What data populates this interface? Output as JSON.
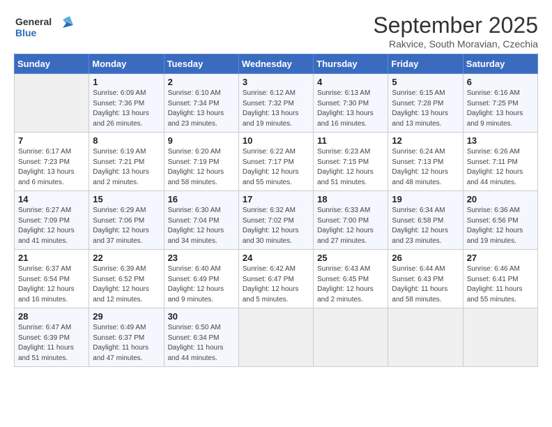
{
  "header": {
    "logo_line1": "General",
    "logo_line2": "Blue",
    "month": "September 2025",
    "location": "Rakvice, South Moravian, Czechia"
  },
  "days_of_week": [
    "Sunday",
    "Monday",
    "Tuesday",
    "Wednesday",
    "Thursday",
    "Friday",
    "Saturday"
  ],
  "weeks": [
    [
      {
        "num": "",
        "info": ""
      },
      {
        "num": "1",
        "info": "Sunrise: 6:09 AM\nSunset: 7:36 PM\nDaylight: 13 hours\nand 26 minutes."
      },
      {
        "num": "2",
        "info": "Sunrise: 6:10 AM\nSunset: 7:34 PM\nDaylight: 13 hours\nand 23 minutes."
      },
      {
        "num": "3",
        "info": "Sunrise: 6:12 AM\nSunset: 7:32 PM\nDaylight: 13 hours\nand 19 minutes."
      },
      {
        "num": "4",
        "info": "Sunrise: 6:13 AM\nSunset: 7:30 PM\nDaylight: 13 hours\nand 16 minutes."
      },
      {
        "num": "5",
        "info": "Sunrise: 6:15 AM\nSunset: 7:28 PM\nDaylight: 13 hours\nand 13 minutes."
      },
      {
        "num": "6",
        "info": "Sunrise: 6:16 AM\nSunset: 7:25 PM\nDaylight: 13 hours\nand 9 minutes."
      }
    ],
    [
      {
        "num": "7",
        "info": "Sunrise: 6:17 AM\nSunset: 7:23 PM\nDaylight: 13 hours\nand 6 minutes."
      },
      {
        "num": "8",
        "info": "Sunrise: 6:19 AM\nSunset: 7:21 PM\nDaylight: 13 hours\nand 2 minutes."
      },
      {
        "num": "9",
        "info": "Sunrise: 6:20 AM\nSunset: 7:19 PM\nDaylight: 12 hours\nand 58 minutes."
      },
      {
        "num": "10",
        "info": "Sunrise: 6:22 AM\nSunset: 7:17 PM\nDaylight: 12 hours\nand 55 minutes."
      },
      {
        "num": "11",
        "info": "Sunrise: 6:23 AM\nSunset: 7:15 PM\nDaylight: 12 hours\nand 51 minutes."
      },
      {
        "num": "12",
        "info": "Sunrise: 6:24 AM\nSunset: 7:13 PM\nDaylight: 12 hours\nand 48 minutes."
      },
      {
        "num": "13",
        "info": "Sunrise: 6:26 AM\nSunset: 7:11 PM\nDaylight: 12 hours\nand 44 minutes."
      }
    ],
    [
      {
        "num": "14",
        "info": "Sunrise: 6:27 AM\nSunset: 7:09 PM\nDaylight: 12 hours\nand 41 minutes."
      },
      {
        "num": "15",
        "info": "Sunrise: 6:29 AM\nSunset: 7:06 PM\nDaylight: 12 hours\nand 37 minutes."
      },
      {
        "num": "16",
        "info": "Sunrise: 6:30 AM\nSunset: 7:04 PM\nDaylight: 12 hours\nand 34 minutes."
      },
      {
        "num": "17",
        "info": "Sunrise: 6:32 AM\nSunset: 7:02 PM\nDaylight: 12 hours\nand 30 minutes."
      },
      {
        "num": "18",
        "info": "Sunrise: 6:33 AM\nSunset: 7:00 PM\nDaylight: 12 hours\nand 27 minutes."
      },
      {
        "num": "19",
        "info": "Sunrise: 6:34 AM\nSunset: 6:58 PM\nDaylight: 12 hours\nand 23 minutes."
      },
      {
        "num": "20",
        "info": "Sunrise: 6:36 AM\nSunset: 6:56 PM\nDaylight: 12 hours\nand 19 minutes."
      }
    ],
    [
      {
        "num": "21",
        "info": "Sunrise: 6:37 AM\nSunset: 6:54 PM\nDaylight: 12 hours\nand 16 minutes."
      },
      {
        "num": "22",
        "info": "Sunrise: 6:39 AM\nSunset: 6:52 PM\nDaylight: 12 hours\nand 12 minutes."
      },
      {
        "num": "23",
        "info": "Sunrise: 6:40 AM\nSunset: 6:49 PM\nDaylight: 12 hours\nand 9 minutes."
      },
      {
        "num": "24",
        "info": "Sunrise: 6:42 AM\nSunset: 6:47 PM\nDaylight: 12 hours\nand 5 minutes."
      },
      {
        "num": "25",
        "info": "Sunrise: 6:43 AM\nSunset: 6:45 PM\nDaylight: 12 hours\nand 2 minutes."
      },
      {
        "num": "26",
        "info": "Sunrise: 6:44 AM\nSunset: 6:43 PM\nDaylight: 11 hours\nand 58 minutes."
      },
      {
        "num": "27",
        "info": "Sunrise: 6:46 AM\nSunset: 6:41 PM\nDaylight: 11 hours\nand 55 minutes."
      }
    ],
    [
      {
        "num": "28",
        "info": "Sunrise: 6:47 AM\nSunset: 6:39 PM\nDaylight: 11 hours\nand 51 minutes."
      },
      {
        "num": "29",
        "info": "Sunrise: 6:49 AM\nSunset: 6:37 PM\nDaylight: 11 hours\nand 47 minutes."
      },
      {
        "num": "30",
        "info": "Sunrise: 6:50 AM\nSunset: 6:34 PM\nDaylight: 11 hours\nand 44 minutes."
      },
      {
        "num": "",
        "info": ""
      },
      {
        "num": "",
        "info": ""
      },
      {
        "num": "",
        "info": ""
      },
      {
        "num": "",
        "info": ""
      }
    ]
  ]
}
